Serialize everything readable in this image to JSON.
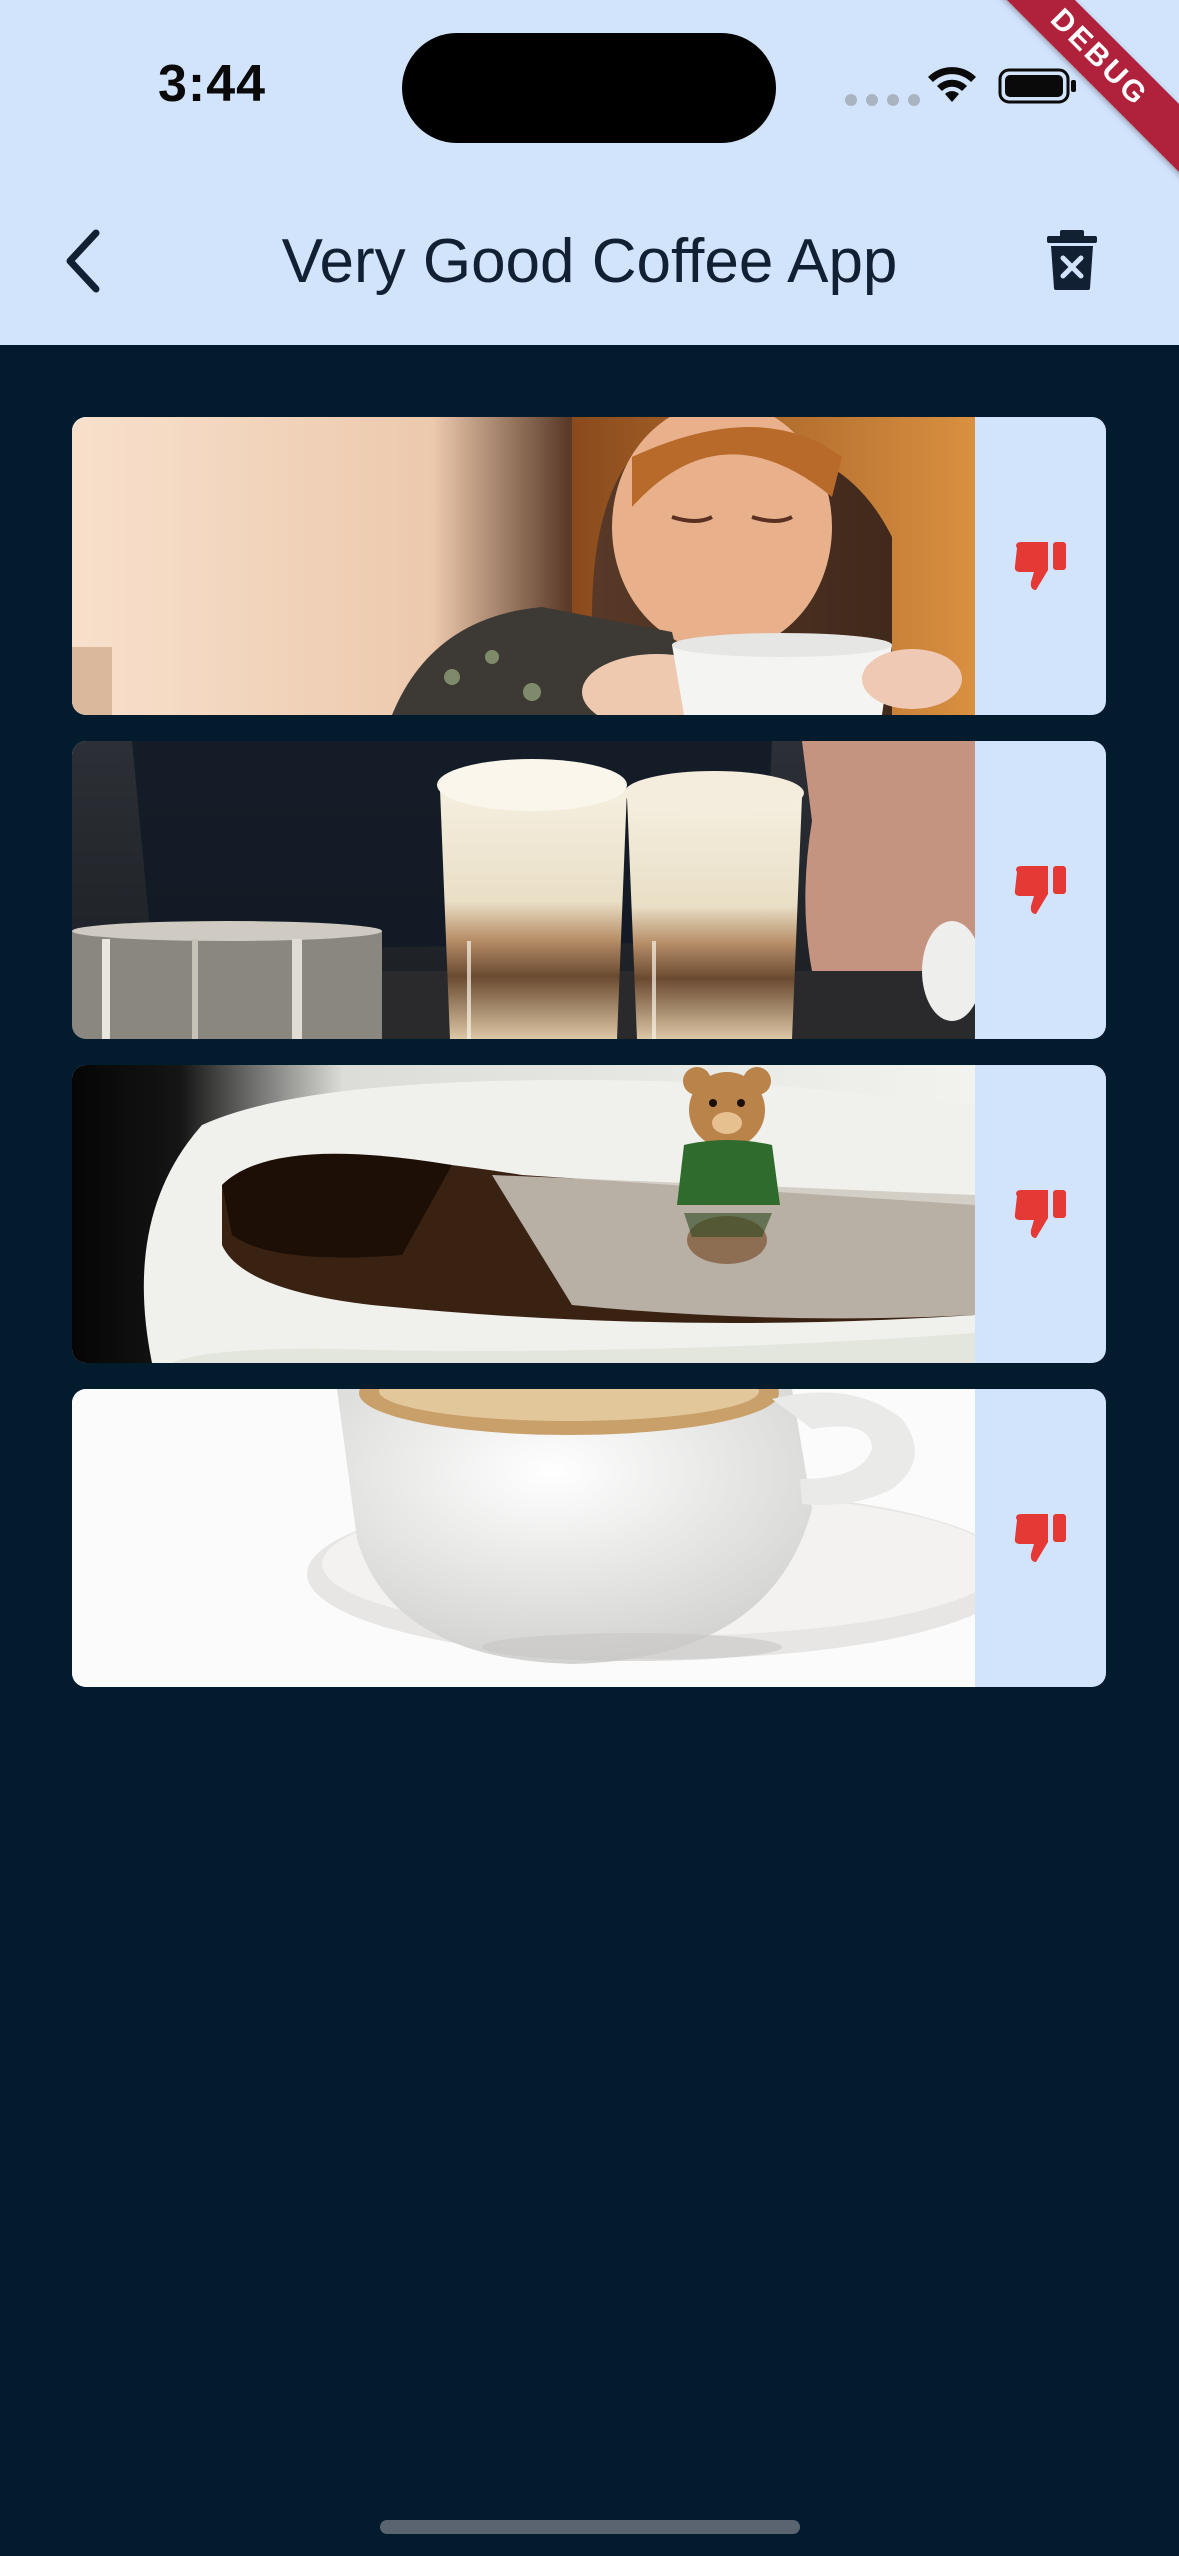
{
  "status_bar": {
    "time": "3:44",
    "debug_label": "DEBUG"
  },
  "app_bar": {
    "title": "Very Good Coffee App",
    "back_icon": "chevron-left-icon",
    "delete_icon": "trash-delete-icon"
  },
  "colors": {
    "app_bar_bg": "#d2e3fc",
    "page_bg": "#021c2e",
    "dislike_icon": "#e53935",
    "debug_banner": "#b0213c"
  },
  "favorites": [
    {
      "image": "woman sipping coffee from a white cup",
      "action_icon": "thumbs-down-icon"
    },
    {
      "image": "two layered latte macchiato glasses",
      "action_icon": "thumbs-down-icon"
    },
    {
      "image": "teddy bear reflected in a cup of black coffee",
      "action_icon": "thumbs-down-icon"
    },
    {
      "image": "white cappuccino cup on saucer",
      "action_icon": "thumbs-down-icon"
    }
  ]
}
